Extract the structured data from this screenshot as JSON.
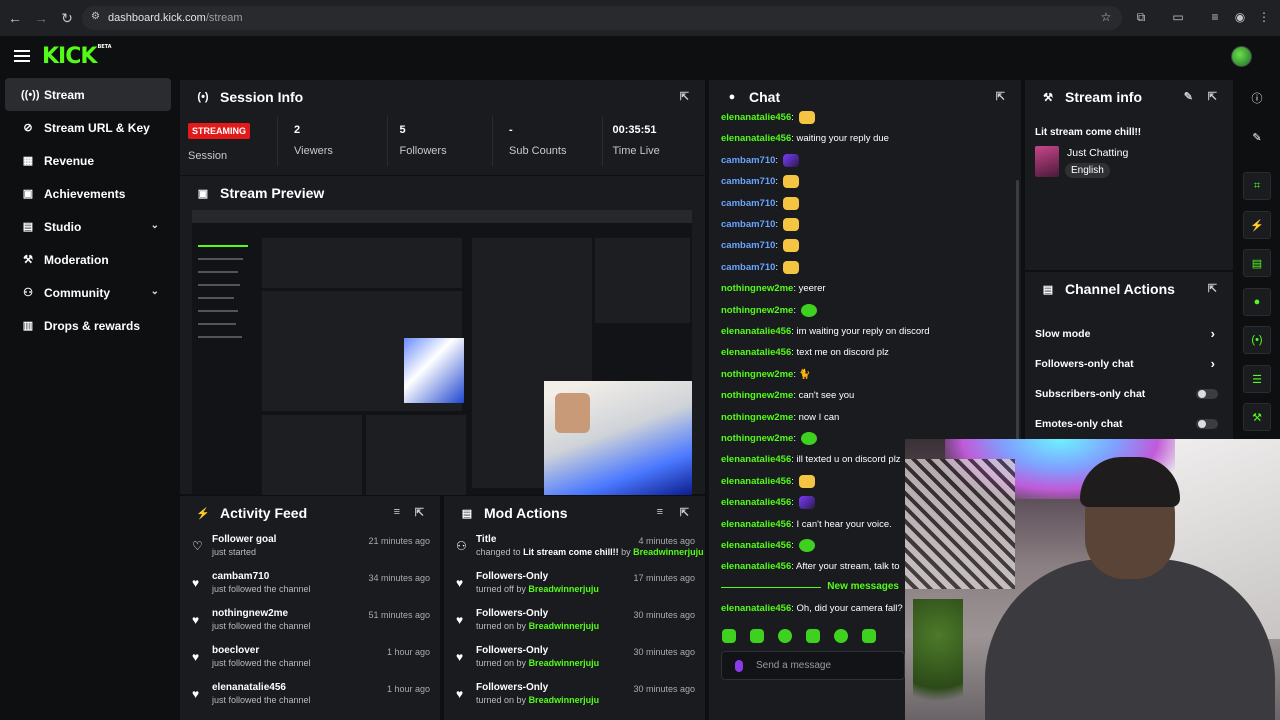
{
  "browser": {
    "url_host": "dashboard.kick.com",
    "url_path": "/stream"
  },
  "brand": {
    "logo": "KICK",
    "beta": "BETA",
    "accent": "#53fc18"
  },
  "sidebar": {
    "items": [
      {
        "label": "Stream",
        "icon": "broadcast-icon"
      },
      {
        "label": "Stream URL & Key",
        "icon": "link-icon"
      },
      {
        "label": "Revenue",
        "icon": "revenue-icon"
      },
      {
        "label": "Achievements",
        "icon": "trophy-icon"
      },
      {
        "label": "Studio",
        "icon": "studio-icon"
      },
      {
        "label": "Moderation",
        "icon": "wrench-icon"
      },
      {
        "label": "Community",
        "icon": "community-icon"
      },
      {
        "label": "Drops & rewards",
        "icon": "gift-icon"
      }
    ]
  },
  "session": {
    "title": "Session Info",
    "badge": "STREAMING",
    "session_label": "Session",
    "viewers_value": "2",
    "viewers_label": "Viewers",
    "followers_value": "5",
    "followers_label": "Followers",
    "subs_value": "-",
    "subs_label": "Sub Counts",
    "time_value": "00:35:51",
    "time_label": "Time Live"
  },
  "preview": {
    "title": "Stream Preview"
  },
  "activity": {
    "title": "Activity Feed",
    "rows": [
      {
        "title": "Follower goal",
        "sub": "just started",
        "time": "21 minutes ago"
      },
      {
        "title": "cambam710",
        "sub": "just followed the channel",
        "time": "34 minutes ago"
      },
      {
        "title": "nothingnew2me",
        "sub": "just followed the channel",
        "time": "51 minutes ago"
      },
      {
        "title": "boeclover",
        "sub": "just followed the channel",
        "time": "1 hour ago"
      },
      {
        "title": "elenanatalie456",
        "sub": "just followed the channel",
        "time": "1 hour ago"
      }
    ]
  },
  "mod": {
    "title": "Mod Actions",
    "rows": [
      {
        "title": "Title",
        "sub_pre": "changed to",
        "sub_bold": "Lit stream come chill!!",
        "sub_mid": "by",
        "sub_user": "Breadwinnerjuju",
        "time": "4 minutes ago"
      },
      {
        "title": "Followers-Only",
        "sub_pre": "turned off by",
        "sub_user": "Breadwinnerjuju",
        "time": "17 minutes ago"
      },
      {
        "title": "Followers-Only",
        "sub_pre": "turned on by",
        "sub_user": "Breadwinnerjuju",
        "time": "30 minutes ago"
      },
      {
        "title": "Followers-Only",
        "sub_pre": "turned on by",
        "sub_user": "Breadwinnerjuju",
        "time": "30 minutes ago"
      },
      {
        "title": "Followers-Only",
        "sub_pre": "turned on by",
        "sub_user": "Breadwinnerjuju",
        "time": "30 minutes ago"
      }
    ]
  },
  "chat": {
    "title": "Chat",
    "messages": [
      {
        "user": "elenanatalie456",
        "text": "",
        "emote": "yellow"
      },
      {
        "user": "elenanatalie456",
        "text": "waiting your reply due"
      },
      {
        "user": "cambam710",
        "text": "",
        "emote": "purple"
      },
      {
        "user": "cambam710",
        "text": "",
        "emote": "yellow"
      },
      {
        "user": "cambam710",
        "text": "",
        "emote": "yellow"
      },
      {
        "user": "cambam710",
        "text": "",
        "emote": "yellow"
      },
      {
        "user": "cambam710",
        "text": "",
        "emote": "yellow"
      },
      {
        "user": "cambam710",
        "text": "",
        "emote": "yellow"
      },
      {
        "user": "nothingnew2me",
        "text": "yeerer"
      },
      {
        "user": "nothingnew2me",
        "text": "",
        "emote": "green"
      },
      {
        "user": "elenanatalie456",
        "text": "im waiting your reply on discord"
      },
      {
        "user": "elenanatalie456",
        "text": "text me on discord plz"
      },
      {
        "user": "nothingnew2me",
        "text": "🐈"
      },
      {
        "user": "nothingnew2me",
        "text": "can't see you"
      },
      {
        "user": "nothingnew2me",
        "text": "now I can"
      },
      {
        "user": "nothingnew2me",
        "text": "",
        "emote": "green"
      },
      {
        "user": "elenanatalie456",
        "text": "ill texted u on discord plz"
      },
      {
        "user": "elenanatalie456",
        "text": "",
        "emote": "yellow"
      },
      {
        "user": "elenanatalie456",
        "text": "",
        "emote": "purple"
      },
      {
        "user": "elenanatalie456",
        "text": "I can't hear your voice."
      },
      {
        "user": "elenanatalie456",
        "text": "",
        "emote": "green"
      },
      {
        "user": "elenanatalie456",
        "text": "After your stream, talk to"
      }
    ],
    "new_messages": "New messages",
    "last_message": {
      "user": "elenanatalie456",
      "text": "Oh, did your camera fall?"
    },
    "input_placeholder": "Send a message"
  },
  "stream_info": {
    "title": "Stream info",
    "stream_title": "Lit stream come chill!!",
    "category": "Just Chatting",
    "language": "English"
  },
  "channel_actions": {
    "title": "Channel Actions",
    "items": [
      {
        "label": "Slow mode",
        "control": "chevron"
      },
      {
        "label": "Followers-only chat",
        "control": "chevron"
      },
      {
        "label": "Subscribers-only chat",
        "control": "toggle"
      },
      {
        "label": "Emotes-only chat",
        "control": "toggle"
      }
    ]
  }
}
